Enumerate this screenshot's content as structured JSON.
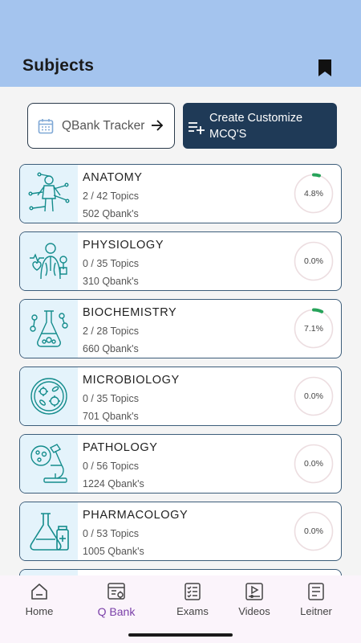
{
  "header": {
    "title": "Subjects"
  },
  "actions": {
    "tracker_label": "QBank Tracker",
    "create_label": "Create Customize MCQ'S"
  },
  "subjects": [
    {
      "name": "ANATOMY",
      "topics": "2 / 42 Topics",
      "qbank": "502 Qbank's",
      "percent_text": "4.8%",
      "progress": 0.048,
      "icon": "anatomy-icon"
    },
    {
      "name": "PHYSIOLOGY",
      "topics": "0 / 35 Topics",
      "qbank": "310 Qbank's",
      "percent_text": "0.0%",
      "progress": 0.0,
      "icon": "physiology-icon"
    },
    {
      "name": "BIOCHEMISTRY",
      "topics": "2 / 28 Topics",
      "qbank": "660 Qbank's",
      "percent_text": "7.1%",
      "progress": 0.071,
      "icon": "biochemistry-icon"
    },
    {
      "name": "MICROBIOLOGY",
      "topics": "0 / 35 Topics",
      "qbank": "701 Qbank's",
      "percent_text": "0.0%",
      "progress": 0.0,
      "icon": "microbiology-icon"
    },
    {
      "name": "PATHOLOGY",
      "topics": "0 / 56 Topics",
      "qbank": "1224 Qbank's",
      "percent_text": "0.0%",
      "progress": 0.0,
      "icon": "pathology-icon"
    },
    {
      "name": "PHARMACOLOGY",
      "topics": "0 / 53 Topics",
      "qbank": "1005 Qbank's",
      "percent_text": "0.0%",
      "progress": 0.0,
      "icon": "pharmacology-icon"
    }
  ],
  "nav": [
    {
      "label": "Home",
      "icon": "home-icon",
      "active": false
    },
    {
      "label": "Q Bank",
      "icon": "qbank-icon",
      "active": true
    },
    {
      "label": "Exams",
      "icon": "exams-icon",
      "active": false
    },
    {
      "label": "Videos",
      "icon": "videos-icon",
      "active": false
    },
    {
      "label": "Leitner",
      "icon": "leitner-icon",
      "active": false
    }
  ],
  "colors": {
    "header_bg": "#a4c4ee",
    "primary_dark": "#1f3a57",
    "progress_green": "#27a35a",
    "ring_track": "#ecdde0",
    "icon_teal": "#148c8c",
    "nav_active": "#7a3fa8"
  }
}
